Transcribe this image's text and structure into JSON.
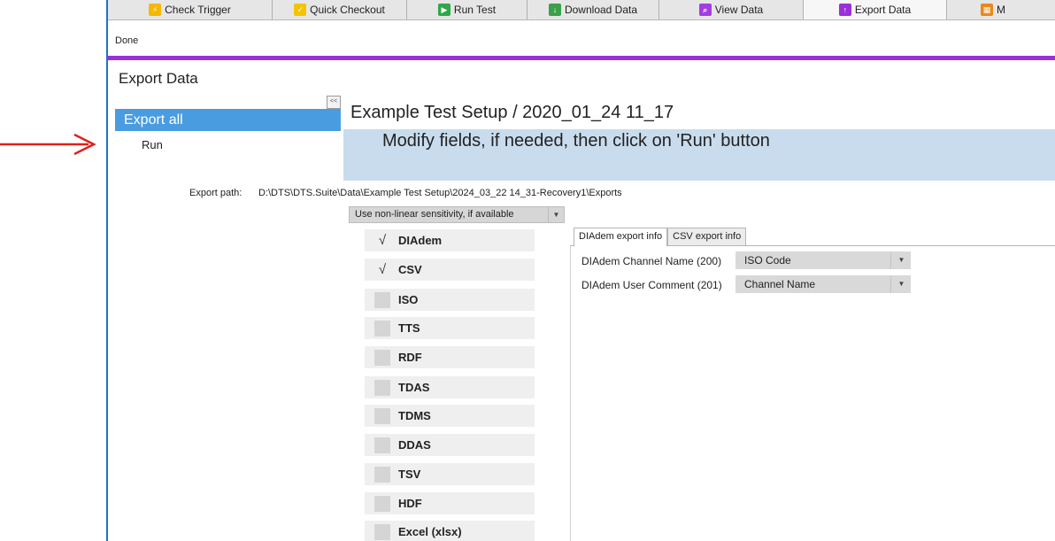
{
  "tabs": [
    {
      "label": "Check Trigger",
      "icon": "check-trigger-icon",
      "color": "#f5b800"
    },
    {
      "label": "Quick Checkout",
      "icon": "quick-checkout-icon",
      "color": "#f5c400"
    },
    {
      "label": "Run Test",
      "icon": "run-test-icon",
      "color": "#2ea84a"
    },
    {
      "label": "Download Data",
      "icon": "download-data-icon",
      "color": "#3aa04a"
    },
    {
      "label": "View Data",
      "icon": "view-data-icon",
      "color": "#a33de0"
    },
    {
      "label": "Export Data",
      "icon": "export-data-icon",
      "color": "#9b30d9"
    },
    {
      "label": "M",
      "icon": "more-tab-icon",
      "color": "#e8891c"
    }
  ],
  "toolbar": {
    "done_label": "Done"
  },
  "page": {
    "title": "Export Data"
  },
  "nav": {
    "collapse_label": "<<",
    "export_all_label": "Export all",
    "run_label": "Run"
  },
  "main": {
    "setup_title": "Example Test Setup / 2020_01_24 11_17",
    "banner_text": "Modify fields, if needed, then click on 'Run' button",
    "export_path_label": "Export path:",
    "export_path_value": "D:\\DTS\\DTS.Suite\\Data\\Example Test Setup\\2024_03_22 14_31-Recovery1\\Exports",
    "sensitivity_option": "Use non-linear sensitivity, if available"
  },
  "formats": [
    {
      "label": "DIAdem",
      "checked": true
    },
    {
      "label": "CSV",
      "checked": true
    },
    {
      "label": "ISO",
      "checked": false
    },
    {
      "label": "TTS",
      "checked": false
    },
    {
      "label": "RDF",
      "checked": false
    },
    {
      "label": "TDAS",
      "checked": false
    },
    {
      "label": "TDMS",
      "checked": false
    },
    {
      "label": "DDAS",
      "checked": false
    },
    {
      "label": "TSV",
      "checked": false
    },
    {
      "label": "HDF",
      "checked": false
    },
    {
      "label": "Excel (xlsx)",
      "checked": false
    }
  ],
  "info_tabs": {
    "diadem_label": "DIAdem export info",
    "csv_label": "CSV export info"
  },
  "diadem_fields": [
    {
      "label": "DIAdem Channel Name (200)",
      "value": "ISO Code"
    },
    {
      "label": "DIAdem User Comment (201)",
      "value": "Channel Name"
    }
  ],
  "colors": {
    "accent_purple": "#9b30d9",
    "nav_selected": "#4a9ce0",
    "banner": "#c9dcee",
    "annotation_arrow": "#e0201a"
  }
}
